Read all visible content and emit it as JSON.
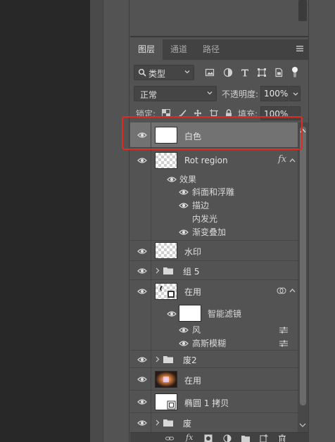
{
  "tabs": [
    {
      "label": "图层"
    },
    {
      "label": "通道"
    },
    {
      "label": "路径"
    }
  ],
  "filter": {
    "kind_label": "类型"
  },
  "blend": {
    "mode": "正常",
    "opacity_label": "不透明度:",
    "opacity_value": "100%"
  },
  "lock": {
    "label": "锁定:",
    "fill_label": "填充:",
    "fill_value": "100%"
  },
  "layers": {
    "l1": {
      "name": "白色"
    },
    "l2": {
      "name": "Rot region",
      "fx": "fx"
    },
    "effects": {
      "header": "效果",
      "bevel": "斜面和浮雕",
      "stroke": "描边",
      "inner_glow": "内发光",
      "gradient": "渐变叠加"
    },
    "l3": {
      "name": "水印"
    },
    "g1": {
      "name": "组 5"
    },
    "l4": {
      "name": "在用",
      "smart_filters": "智能滤镜",
      "wind": "风",
      "blur": "高斯模糊"
    },
    "g2": {
      "name": "废2"
    },
    "l5": {
      "name": "在用"
    },
    "l6": {
      "name": "椭圆 1 拷贝"
    },
    "g3": {
      "name": "废"
    }
  },
  "bottom": {
    "fx": "fx"
  },
  "colors": {
    "highlight": "#e02a24",
    "selected_row": "#727272"
  }
}
